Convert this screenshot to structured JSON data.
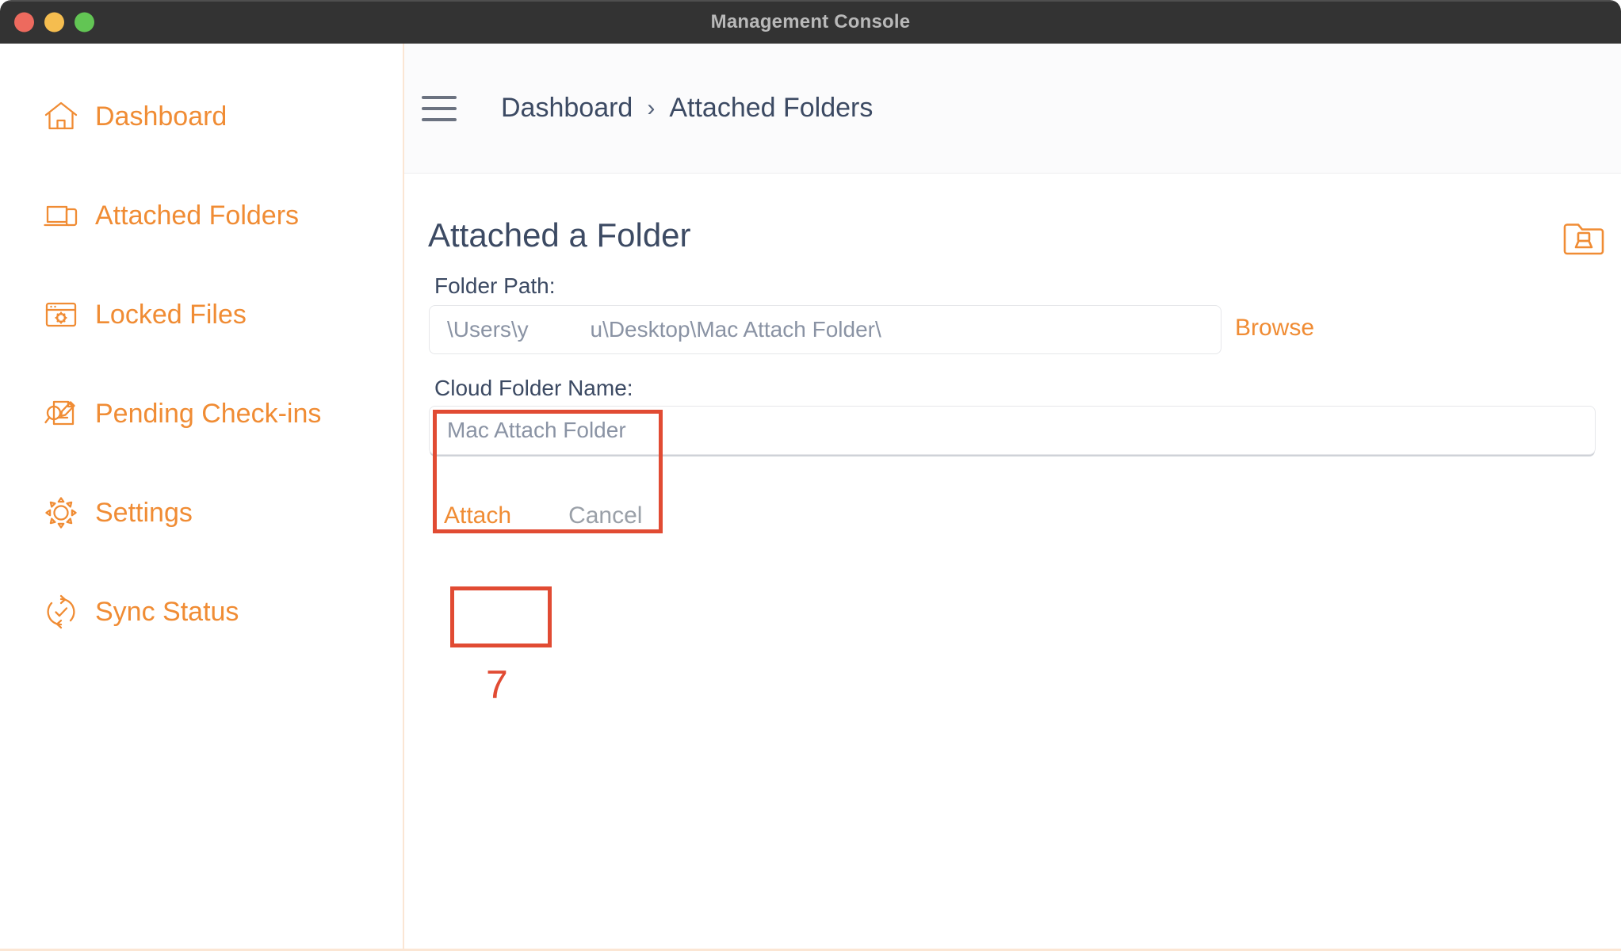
{
  "window": {
    "title": "Management Console",
    "traffic_lights": [
      "close",
      "minimize",
      "zoom"
    ]
  },
  "sidebar": {
    "items": [
      {
        "icon": "home-icon",
        "label": "Dashboard"
      },
      {
        "icon": "devices-icon",
        "label": "Attached Folders"
      },
      {
        "icon": "locked-window-icon",
        "label": "Locked Files"
      },
      {
        "icon": "document-edit-icon",
        "label": "Pending Check-ins"
      },
      {
        "icon": "gear-icon",
        "label": "Settings"
      },
      {
        "icon": "sync-icon",
        "label": "Sync Status"
      }
    ]
  },
  "header": {
    "menu_icon": "hamburger-icon",
    "breadcrumb": {
      "root": "Dashboard",
      "separator": "›",
      "current": "Attached Folders"
    }
  },
  "content": {
    "page_title": "Attached a Folder",
    "corner_icon": "folder-device-icon",
    "folder_path": {
      "label": "Folder Path:",
      "value": "\\Users\\y          u\\Desktop\\Mac Attach Folder\\",
      "browse_label": "Browse"
    },
    "cloud_folder_name": {
      "label": "Cloud Folder Name:",
      "value": "Mac Attach Folder"
    },
    "actions": {
      "attach_label": "Attach",
      "cancel_label": "Cancel"
    }
  },
  "annotations": {
    "step_number": "7",
    "highlight_color": "#e14b33",
    "highlighted": [
      "cloud-folder-name-field",
      "attach-button"
    ]
  },
  "colors": {
    "accent_orange": "#f08c34",
    "titlebar": "#333333",
    "text_dark": "#3c4a63",
    "muted_text": "#8a93a4",
    "annotation_red": "#e14b33",
    "sidebar_divider": "#fbe6d4"
  }
}
